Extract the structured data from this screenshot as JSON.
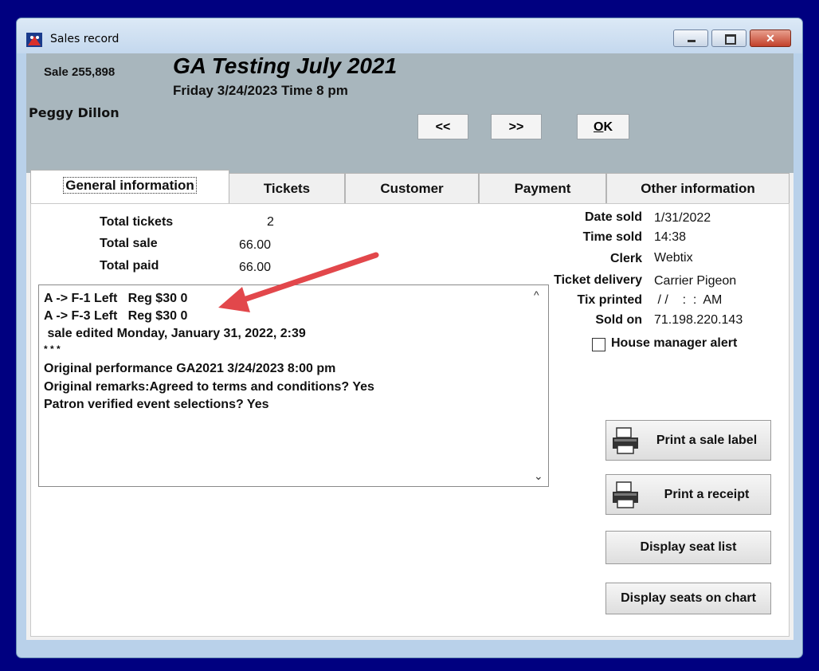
{
  "window": {
    "title": "Sales record",
    "close_glyph": "✕"
  },
  "header": {
    "sale_number": "Sale 255,898",
    "event_title": "GA Testing July 2021",
    "event_subtitle": "Friday 3/24/2023  Time 8 pm",
    "patron_name": "Peggy Dillon",
    "prev_label": "<<",
    "next_label": ">>",
    "ok_label": "OK"
  },
  "tabs": [
    {
      "label": "General information",
      "active": true
    },
    {
      "label": "Tickets"
    },
    {
      "label": "Customer"
    },
    {
      "label": "Payment"
    },
    {
      "label": "Other information"
    }
  ],
  "totals": {
    "total_tickets_label": "Total tickets",
    "total_tickets": "2",
    "total_sale_label": "Total sale",
    "total_sale": "66.00",
    "total_paid_label": "Total paid",
    "total_paid": "66.00"
  },
  "details": {
    "date_sold_label": "Date sold",
    "date_sold": "1/31/2022",
    "time_sold_label": "Time sold",
    "time_sold": "14:38",
    "clerk_label": "Clerk",
    "clerk": "Webtix",
    "ticket_delivery_label": "Ticket delivery",
    "ticket_delivery": "Carrier Pigeon",
    "tix_printed_label": "Tix printed",
    "tix_printed": " / /    :  :  AM",
    "sold_on_label": "Sold on",
    "sold_on": "71.198.220.143",
    "house_manager_alert_label": "House manager alert",
    "house_manager_alert": false
  },
  "notes": [
    "A -> F-1 Left   Reg $30 0",
    "A -> F-3 Left   Reg $30 0",
    " sale edited Monday, January 31, 2022, 2:39",
    "* * *",
    "Original performance GA2021 3/24/2023 8:00 pm",
    "Original remarks:Agreed to terms and conditions? Yes",
    "Patron verified event selections? Yes"
  ],
  "scroll": {
    "up_glyph": "^",
    "down_glyph": "⌄"
  },
  "actions": {
    "print_sale_label": "Print a sale label",
    "print_receipt": "Print a receipt",
    "display_seat_list": "Display seat list",
    "display_seats_on_chart": "Display seats on chart"
  },
  "colors": {
    "desktop": "#000080",
    "header": "#a8b6bd",
    "annotation_arrow": "#e2474b"
  },
  "icons": [
    "app-icon",
    "minimize-icon",
    "maximize-icon",
    "close-icon",
    "printer-icon",
    "scroll-up-icon",
    "scroll-down-icon",
    "annotation-arrow"
  ]
}
